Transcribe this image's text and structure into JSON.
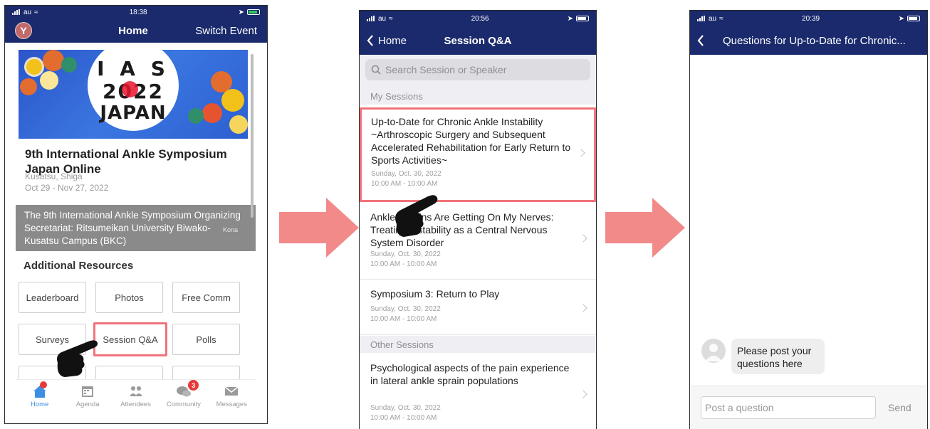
{
  "colors": {
    "navbar": "#1a2a6c",
    "highlight": "#f0737b",
    "arrow": "#f28a8a",
    "active_tab": "#3d8fe3"
  },
  "screen1": {
    "status_time": "18:38",
    "carrier": "au",
    "avatar_initial": "Y",
    "nav_title": "Home",
    "nav_right": "Switch Event",
    "banner_lines": [
      "I A S",
      "2022",
      "JAPAN"
    ],
    "event_title": "9th International Ankle Symposium Japan Online",
    "location": "Kusatsu, Shiga",
    "dates": "Oct 29 - Nov 27, 2022",
    "map_text": "The 9th International Ankle Symposium Organizing Secretariat: Ritsumeikan University Biwako-Kusatsu Campus (BKC)",
    "map_label": "Kona",
    "resources_title": "Additional Resources",
    "resources": [
      "Leaderboard",
      "Photos",
      "Free Comm",
      "Surveys",
      "Session Q&A",
      "Polls"
    ],
    "tabs": [
      {
        "label": "Home",
        "icon": "home-icon"
      },
      {
        "label": "Agenda",
        "icon": "calendar-icon"
      },
      {
        "label": "Attendees",
        "icon": "people-icon"
      },
      {
        "label": "Community",
        "icon": "chat-bubbles-icon",
        "badge": "3"
      },
      {
        "label": "Messages",
        "icon": "envelope-icon"
      }
    ]
  },
  "screen2": {
    "status_time": "20:56",
    "carrier": "au",
    "back_label": "Home",
    "nav_title": "Session Q&A",
    "search_placeholder": "Search Session or Speaker",
    "my_sessions_label": "My Sessions",
    "other_sessions_label": "Other Sessions",
    "my_sessions": [
      {
        "title": "Up-to-Date for Chronic Ankle Instability ~Arthroscopic Surgery and Subsequent Accelerated Rehabilitation for Early Return to Sports Activities~",
        "date": "Sunday, Oct. 30, 2022",
        "time": "10:00 AM - 10:00 AM"
      },
      {
        "title": "Ankle Sprains Are Getting On My Nerves: Treating Instability as a Central Nervous System Disorder",
        "date": "Sunday, Oct. 30, 2022",
        "time": "10:00 AM - 10:00 AM"
      },
      {
        "title": "Symposium 3: Return to Play",
        "date": "Sunday, Oct. 30, 2022",
        "time": "10:00 AM - 10:00 AM"
      }
    ],
    "other_sessions": [
      {
        "title": "Psychological aspects of the pain experience in lateral ankle sprain populations",
        "date": "Sunday, Oct. 30, 2022",
        "time": "10:00 AM - 10:00 AM"
      }
    ]
  },
  "screen3": {
    "status_time": "20:39",
    "carrier": "au",
    "nav_title": "Questions for Up-to-Date for Chronic...",
    "message": "Please post your questions here",
    "input_placeholder": "Post a question",
    "send_label": "Send"
  }
}
